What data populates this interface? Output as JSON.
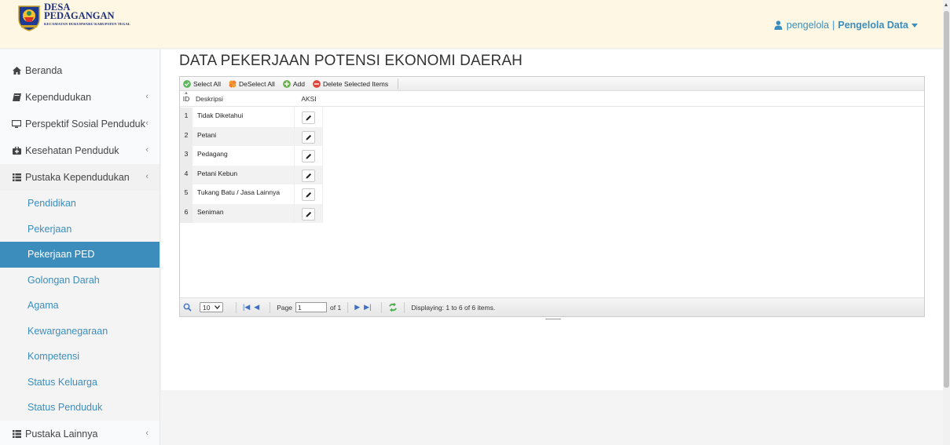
{
  "header": {
    "brand_line1": "DESA",
    "brand_line2": "PEDAGANGAN",
    "brand_line3": "KECAMATAN DUKUHWARU KABUPATEN TEGAL",
    "user_name": "pengelola",
    "user_separator": "|",
    "user_role": "Pengelola Data"
  },
  "sidebar": {
    "items": [
      {
        "label": "Beranda",
        "icon": "home-icon"
      },
      {
        "label": "Kependudukan",
        "icon": "book-icon"
      },
      {
        "label": "Perspektif Sosial Penduduk",
        "icon": "desktop-icon"
      },
      {
        "label": "Kesehatan Penduduk",
        "icon": "medkit-icon"
      },
      {
        "label": "Pustaka Kependudukan",
        "icon": "list-icon"
      }
    ],
    "submenu": [
      "Pendidikan",
      "Pekerjaan",
      "Pekerjaan PED",
      "Golongan Darah",
      "Agama",
      "Kewarganegaraan",
      "Kompetensi",
      "Status Keluarga",
      "Status Penduduk"
    ],
    "active_submenu": "Pekerjaan PED",
    "last_item": {
      "label": "Pustaka Lainnya",
      "icon": "list-icon"
    },
    "chevron": "‹"
  },
  "main": {
    "title": "DATA PEKERJAAN POTENSI EKONOMI DAERAH",
    "toolbar": {
      "select_all": "Select All",
      "deselect_all": "DeSelect All",
      "add": "Add",
      "delete_selected": "Delete Selected Items"
    },
    "columns": {
      "id": "ID",
      "desc": "Deskripsi",
      "aksi": "AKSI"
    },
    "rows": [
      {
        "id": "1",
        "desc": "Tidak Diketahui"
      },
      {
        "id": "2",
        "desc": "Petani"
      },
      {
        "id": "3",
        "desc": "Pedagang"
      },
      {
        "id": "4",
        "desc": "Petani Kebun"
      },
      {
        "id": "5",
        "desc": "Tukang Batu / Jasa Lainnya"
      },
      {
        "id": "6",
        "desc": "Seniman"
      }
    ],
    "pager": {
      "per_page": "10",
      "page_label": "Page",
      "page_value": "1",
      "of_label": "of 1",
      "display_text": "Displaying: 1 to 6 of 6 items."
    }
  },
  "colors": {
    "accent": "#3c8dbc",
    "header_bg": "#fdf7e3"
  }
}
